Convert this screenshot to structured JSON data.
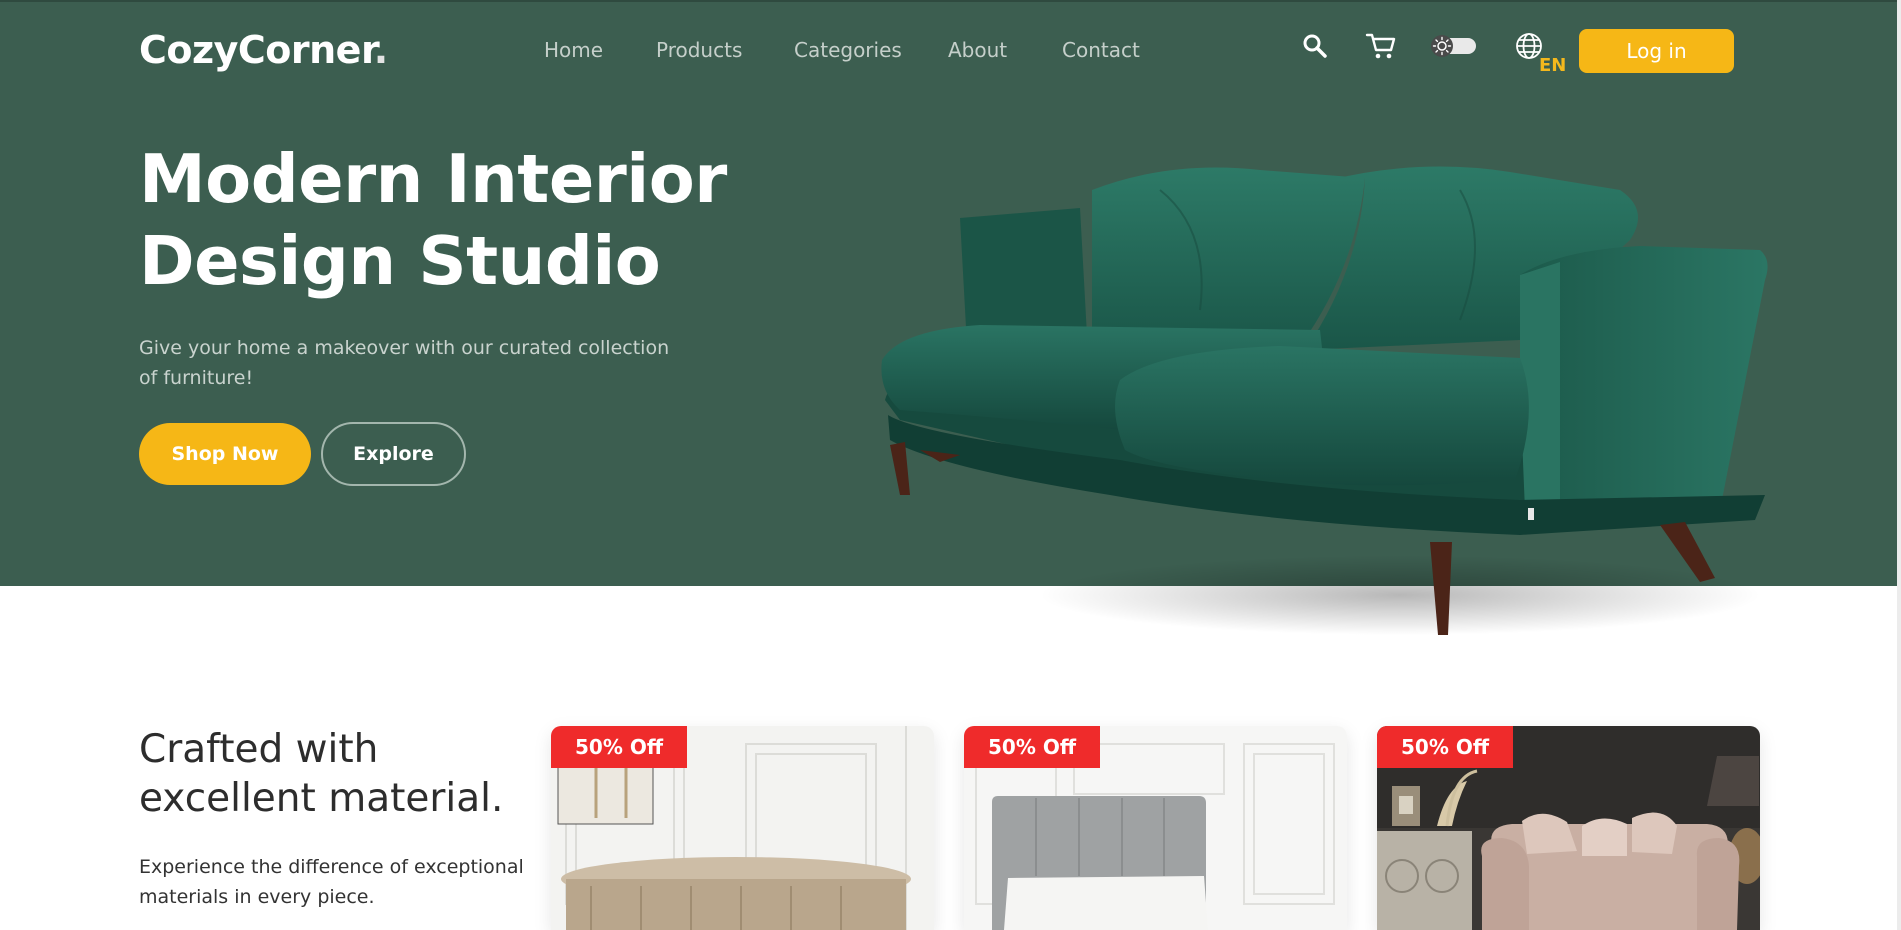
{
  "brand": {
    "name": "CozyCorner",
    "dot": "."
  },
  "nav": {
    "items": [
      {
        "label": "Home"
      },
      {
        "label": "Products"
      },
      {
        "label": "Categories"
      },
      {
        "label": "About"
      },
      {
        "label": "Contact"
      }
    ]
  },
  "header": {
    "icons": [
      "search-icon",
      "cart-icon",
      "theme-toggle",
      "globe-icon"
    ],
    "language": "EN",
    "login_label": "Log in"
  },
  "hero": {
    "title": "Modern Interior Design Studio",
    "subtitle": "Give your home a makeover with our curated collection of furniture!",
    "primary_cta": "Shop Now",
    "secondary_cta": "Explore"
  },
  "features": {
    "title": "Crafted with excellent material.",
    "text": "Experience the difference of exceptional materials in every piece."
  },
  "products": [
    {
      "badge": "50% Off"
    },
    {
      "badge": "50% Off"
    },
    {
      "badge": "50% Off"
    }
  ],
  "colors": {
    "hero_bg": "#3c5e50",
    "accent": "#f6b716",
    "badge": "#ef2b2b",
    "sofa": "#1f5e50"
  }
}
